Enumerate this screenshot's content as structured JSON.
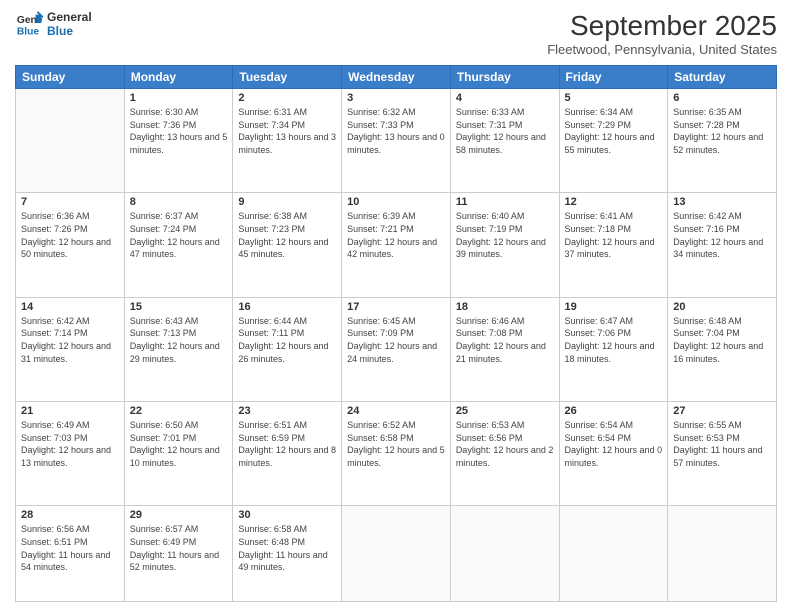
{
  "logo": {
    "line1": "General",
    "line2": "Blue"
  },
  "title": "September 2025",
  "location": "Fleetwood, Pennsylvania, United States",
  "days_header": [
    "Sunday",
    "Monday",
    "Tuesday",
    "Wednesday",
    "Thursday",
    "Friday",
    "Saturday"
  ],
  "weeks": [
    [
      {
        "day": "",
        "info": ""
      },
      {
        "day": "1",
        "info": "Sunrise: 6:30 AM\nSunset: 7:36 PM\nDaylight: 13 hours\nand 5 minutes."
      },
      {
        "day": "2",
        "info": "Sunrise: 6:31 AM\nSunset: 7:34 PM\nDaylight: 13 hours\nand 3 minutes."
      },
      {
        "day": "3",
        "info": "Sunrise: 6:32 AM\nSunset: 7:33 PM\nDaylight: 13 hours\nand 0 minutes."
      },
      {
        "day": "4",
        "info": "Sunrise: 6:33 AM\nSunset: 7:31 PM\nDaylight: 12 hours\nand 58 minutes."
      },
      {
        "day": "5",
        "info": "Sunrise: 6:34 AM\nSunset: 7:29 PM\nDaylight: 12 hours\nand 55 minutes."
      },
      {
        "day": "6",
        "info": "Sunrise: 6:35 AM\nSunset: 7:28 PM\nDaylight: 12 hours\nand 52 minutes."
      }
    ],
    [
      {
        "day": "7",
        "info": "Sunrise: 6:36 AM\nSunset: 7:26 PM\nDaylight: 12 hours\nand 50 minutes."
      },
      {
        "day": "8",
        "info": "Sunrise: 6:37 AM\nSunset: 7:24 PM\nDaylight: 12 hours\nand 47 minutes."
      },
      {
        "day": "9",
        "info": "Sunrise: 6:38 AM\nSunset: 7:23 PM\nDaylight: 12 hours\nand 45 minutes."
      },
      {
        "day": "10",
        "info": "Sunrise: 6:39 AM\nSunset: 7:21 PM\nDaylight: 12 hours\nand 42 minutes."
      },
      {
        "day": "11",
        "info": "Sunrise: 6:40 AM\nSunset: 7:19 PM\nDaylight: 12 hours\nand 39 minutes."
      },
      {
        "day": "12",
        "info": "Sunrise: 6:41 AM\nSunset: 7:18 PM\nDaylight: 12 hours\nand 37 minutes."
      },
      {
        "day": "13",
        "info": "Sunrise: 6:42 AM\nSunset: 7:16 PM\nDaylight: 12 hours\nand 34 minutes."
      }
    ],
    [
      {
        "day": "14",
        "info": "Sunrise: 6:42 AM\nSunset: 7:14 PM\nDaylight: 12 hours\nand 31 minutes."
      },
      {
        "day": "15",
        "info": "Sunrise: 6:43 AM\nSunset: 7:13 PM\nDaylight: 12 hours\nand 29 minutes."
      },
      {
        "day": "16",
        "info": "Sunrise: 6:44 AM\nSunset: 7:11 PM\nDaylight: 12 hours\nand 26 minutes."
      },
      {
        "day": "17",
        "info": "Sunrise: 6:45 AM\nSunset: 7:09 PM\nDaylight: 12 hours\nand 24 minutes."
      },
      {
        "day": "18",
        "info": "Sunrise: 6:46 AM\nSunset: 7:08 PM\nDaylight: 12 hours\nand 21 minutes."
      },
      {
        "day": "19",
        "info": "Sunrise: 6:47 AM\nSunset: 7:06 PM\nDaylight: 12 hours\nand 18 minutes."
      },
      {
        "day": "20",
        "info": "Sunrise: 6:48 AM\nSunset: 7:04 PM\nDaylight: 12 hours\nand 16 minutes."
      }
    ],
    [
      {
        "day": "21",
        "info": "Sunrise: 6:49 AM\nSunset: 7:03 PM\nDaylight: 12 hours\nand 13 minutes."
      },
      {
        "day": "22",
        "info": "Sunrise: 6:50 AM\nSunset: 7:01 PM\nDaylight: 12 hours\nand 10 minutes."
      },
      {
        "day": "23",
        "info": "Sunrise: 6:51 AM\nSunset: 6:59 PM\nDaylight: 12 hours\nand 8 minutes."
      },
      {
        "day": "24",
        "info": "Sunrise: 6:52 AM\nSunset: 6:58 PM\nDaylight: 12 hours\nand 5 minutes."
      },
      {
        "day": "25",
        "info": "Sunrise: 6:53 AM\nSunset: 6:56 PM\nDaylight: 12 hours\nand 2 minutes."
      },
      {
        "day": "26",
        "info": "Sunrise: 6:54 AM\nSunset: 6:54 PM\nDaylight: 12 hours\nand 0 minutes."
      },
      {
        "day": "27",
        "info": "Sunrise: 6:55 AM\nSunset: 6:53 PM\nDaylight: 11 hours\nand 57 minutes."
      }
    ],
    [
      {
        "day": "28",
        "info": "Sunrise: 6:56 AM\nSunset: 6:51 PM\nDaylight: 11 hours\nand 54 minutes."
      },
      {
        "day": "29",
        "info": "Sunrise: 6:57 AM\nSunset: 6:49 PM\nDaylight: 11 hours\nand 52 minutes."
      },
      {
        "day": "30",
        "info": "Sunrise: 6:58 AM\nSunset: 6:48 PM\nDaylight: 11 hours\nand 49 minutes."
      },
      {
        "day": "",
        "info": ""
      },
      {
        "day": "",
        "info": ""
      },
      {
        "day": "",
        "info": ""
      },
      {
        "day": "",
        "info": ""
      }
    ]
  ]
}
